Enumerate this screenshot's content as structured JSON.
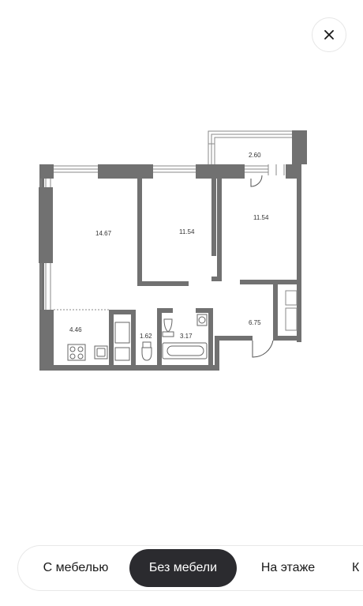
{
  "header": {
    "close_icon": "close-icon"
  },
  "floorplan": {
    "rooms": [
      {
        "id": "room-1",
        "area": "14.67"
      },
      {
        "id": "room-2",
        "area": "11.54"
      },
      {
        "id": "room-3",
        "area": "11.54"
      },
      {
        "id": "balcony",
        "area": "2.60"
      },
      {
        "id": "kitchen",
        "area": "4.46"
      },
      {
        "id": "toilet",
        "area": "1.62"
      },
      {
        "id": "bathroom",
        "area": "3.17"
      },
      {
        "id": "hallway",
        "area": "6.75"
      }
    ]
  },
  "tabs": {
    "items": [
      {
        "label": "С мебелью",
        "active": false
      },
      {
        "label": "Без мебели",
        "active": true
      },
      {
        "label": "На этаже",
        "active": false
      },
      {
        "label": "К",
        "active": false
      }
    ]
  },
  "colors": {
    "wall": "#717171",
    "active_tab_bg": "#2b2b2f"
  }
}
